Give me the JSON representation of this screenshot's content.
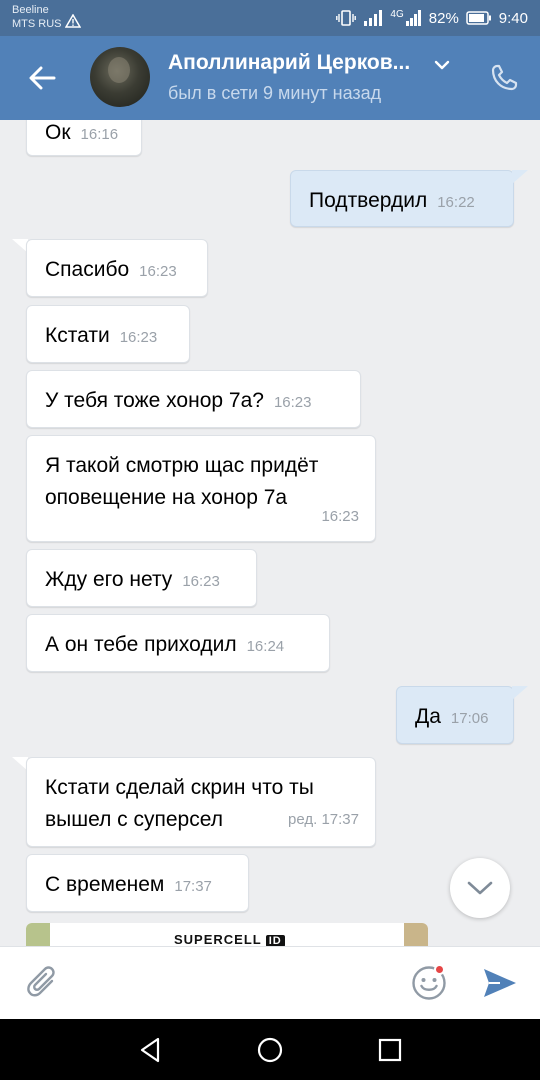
{
  "status": {
    "carrier1": "Beeline",
    "carrier2": "MTS RUS",
    "network": "4G",
    "battery": "82%",
    "time": "9:40"
  },
  "header": {
    "name": "Аполлинарий Церков...",
    "last_seen": "был в сети 9 минут назад"
  },
  "messages": [
    {
      "dir": "in",
      "text": "Ок",
      "time": "16:16"
    },
    {
      "dir": "out",
      "text": "Подтвердил",
      "time": "16:22"
    },
    {
      "dir": "in",
      "text": "Спасибо",
      "time": "16:23"
    },
    {
      "dir": "in",
      "text": "Кстати",
      "time": "16:23"
    },
    {
      "dir": "in",
      "text": "У тебя тоже хонор 7а?",
      "time": "16:23"
    },
    {
      "dir": "in",
      "text": "Я такой смотрю щас придёт оповещение на хонор 7а",
      "time": "16:23"
    },
    {
      "dir": "in",
      "text": "Жду его нету",
      "time": "16:23"
    },
    {
      "dir": "in",
      "text": "А он тебе приходил",
      "time": "16:24"
    },
    {
      "dir": "out",
      "text": "Да",
      "time": "17:06"
    },
    {
      "dir": "in",
      "text": "Кстати сделай скрин что ты вышел с суперсел",
      "time": "ред. 17:37"
    },
    {
      "dir": "in",
      "text": "С временем",
      "time": "17:37"
    }
  ],
  "attachment": {
    "logo": "SUPERCELL",
    "logo_badge": "ID"
  },
  "input": {
    "placeholder": ""
  },
  "colors": {
    "header": "#5181b8",
    "statusbar": "#4a6f99",
    "accent": "#5181b8",
    "bg": "#edeef0",
    "out_bubble": "#dce9f6"
  },
  "icons": [
    "back-arrow-icon",
    "chevron-down-icon",
    "phone-icon",
    "scroll-down-icon",
    "paperclip-icon",
    "sticker-icon",
    "send-icon",
    "nav-back-icon",
    "nav-home-icon",
    "nav-recent-icon"
  ]
}
